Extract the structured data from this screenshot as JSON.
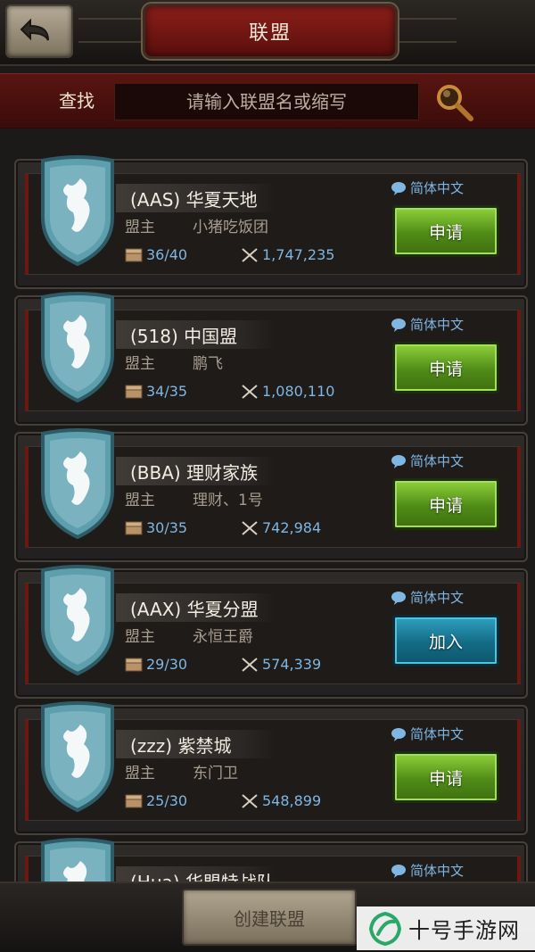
{
  "header": {
    "title": "联盟",
    "back_icon": "back-arrow-icon"
  },
  "search": {
    "label": "查找",
    "placeholder": "请输入联盟名或缩写",
    "icon": "magnifier-icon"
  },
  "alliances": [
    {
      "name": "(AAS) 华夏天地",
      "leader_label": "盟主",
      "leader": "小猪吃饭团",
      "members": "36/40",
      "power": "1,747,235",
      "language": "简体中文",
      "action": "申请",
      "action_type": "apply"
    },
    {
      "name": "(518) 中国盟",
      "leader_label": "盟主",
      "leader": "鹏飞",
      "members": "34/35",
      "power": "1,080,110",
      "language": "简体中文",
      "action": "申请",
      "action_type": "apply"
    },
    {
      "name": "(BBA) 理财家族",
      "leader_label": "盟主",
      "leader": "理财、1号",
      "members": "30/35",
      "power": "742,984",
      "language": "简体中文",
      "action": "申请",
      "action_type": "apply"
    },
    {
      "name": "(AAX) 华夏分盟",
      "leader_label": "盟主",
      "leader": "永恒王爵",
      "members": "29/30",
      "power": "574,339",
      "language": "简体中文",
      "action": "加入",
      "action_type": "join"
    },
    {
      "name": "(zzz) 紫禁城",
      "leader_label": "盟主",
      "leader": "东门卫",
      "members": "25/30",
      "power": "548,899",
      "language": "简体中文",
      "action": "申请",
      "action_type": "apply"
    },
    {
      "name": "(Hua) 华盟特战队",
      "leader_label": "",
      "leader": "",
      "members": "",
      "power": "",
      "language": "简体中文",
      "action": "",
      "action_type": ""
    }
  ],
  "footer": {
    "create_label": "创建联盟"
  },
  "watermark": {
    "text": "十号手游网"
  },
  "colors": {
    "accent_red": "#6b1712",
    "apply_green": "#4f8c17",
    "join_blue": "#136b85",
    "stat_blue": "#7fb6e2"
  }
}
